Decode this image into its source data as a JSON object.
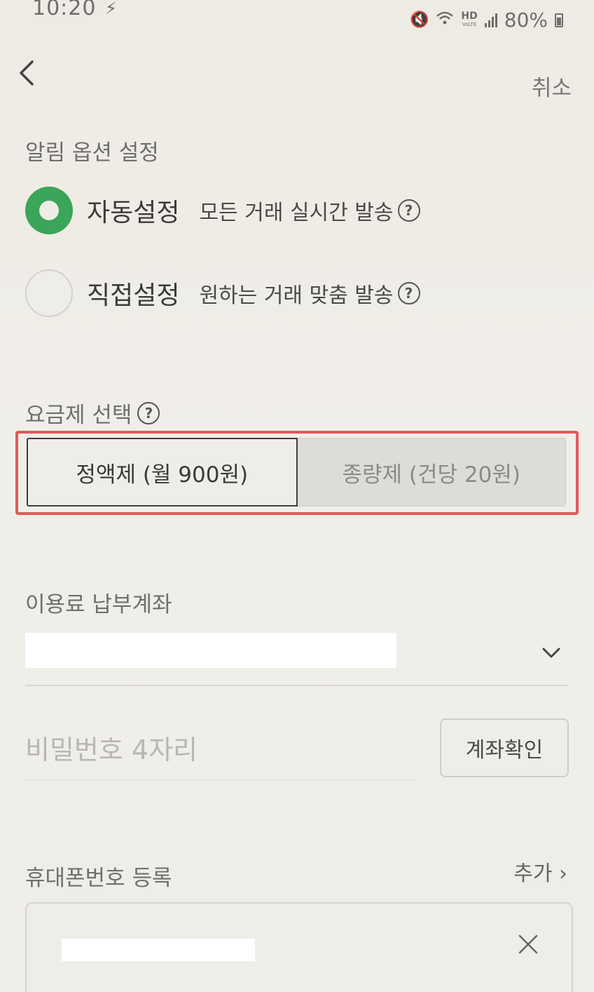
{
  "status_bar": {
    "time": "10:20",
    "battery": "80%",
    "network_label": "HD",
    "network_sublabel": "VoLTE"
  },
  "header": {
    "cancel_label": "취소"
  },
  "notification": {
    "section_label": "알림 옵션 설정",
    "options": [
      {
        "title": "자동설정",
        "description": "모든 거래 실시간 발송",
        "selected": true
      },
      {
        "title": "직접설정",
        "description": "원하는 거래 맞춤 발송",
        "selected": false
      }
    ]
  },
  "plan": {
    "section_label": "요금제 선택",
    "options": [
      {
        "label": "정액제 (월 900원)",
        "selected": true
      },
      {
        "label": "종량제 (건당 20원)",
        "selected": false
      }
    ],
    "highlight_color": "#e05a5a"
  },
  "account": {
    "section_label": "이용료 납부계좌",
    "pin_placeholder": "비밀번호 4자리",
    "verify_label": "계좌확인"
  },
  "phone": {
    "section_label": "휴대폰번호 등록",
    "add_label": "추가 ›"
  },
  "colors": {
    "accent_green": "#3ba55a",
    "background": "#eeece6"
  }
}
